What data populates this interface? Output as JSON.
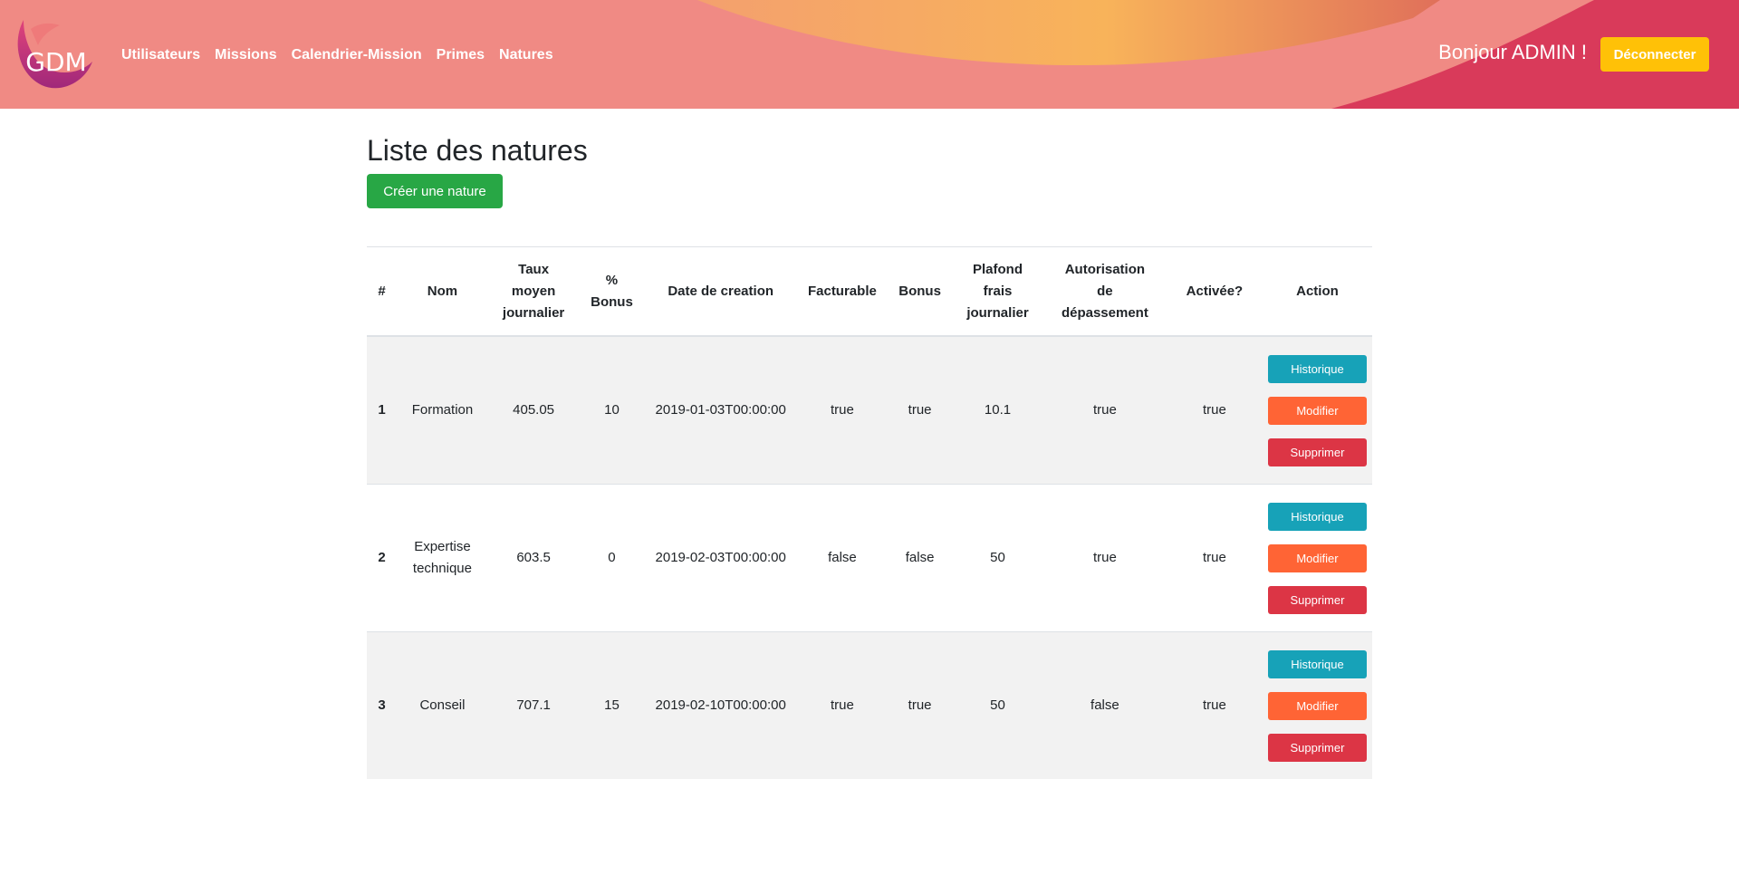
{
  "header": {
    "logo_text": "GDM",
    "nav": [
      "Utilisateurs",
      "Missions",
      "Calendrier-Mission",
      "Primes",
      "Natures"
    ],
    "greeting": "Bonjour ADMIN !",
    "logout_label": "Déconnecter",
    "colors": {
      "base": "#f08a84",
      "wave": "#f7b05a",
      "accent": "#d93a5a",
      "logout": "#ffc107"
    }
  },
  "page": {
    "title": "Liste des natures",
    "create_label": "Créer une nature"
  },
  "table": {
    "headers": {
      "idx": "#",
      "nom": "Nom",
      "taux": [
        "Taux",
        "moyen",
        "journalier"
      ],
      "bonus_pct": [
        "%",
        "Bonus"
      ],
      "date": "Date de creation",
      "facturable": "Facturable",
      "bonus": "Bonus",
      "plafond": [
        "Plafond",
        "frais",
        "journalier"
      ],
      "autorisation": [
        "Autorisation",
        "de",
        "dépassement"
      ],
      "activee": "Activée?",
      "action": "Action"
    },
    "rows": [
      {
        "idx": "1",
        "nom": [
          "Formation"
        ],
        "taux": "405.05",
        "bonus_pct": "10",
        "date": "2019-01-03T00:00:00",
        "facturable": "true",
        "bonus": "true",
        "plafond": "10.1",
        "autorisation": "true",
        "activee": "true"
      },
      {
        "idx": "2",
        "nom": [
          "Expertise",
          "technique"
        ],
        "taux": "603.5",
        "bonus_pct": "0",
        "date": "2019-02-03T00:00:00",
        "facturable": "false",
        "bonus": "false",
        "plafond": "50",
        "autorisation": "true",
        "activee": "true"
      },
      {
        "idx": "3",
        "nom": [
          "Conseil"
        ],
        "taux": "707.1",
        "bonus_pct": "15",
        "date": "2019-02-10T00:00:00",
        "facturable": "true",
        "bonus": "true",
        "plafond": "50",
        "autorisation": "false",
        "activee": "true"
      }
    ],
    "action_labels": {
      "historique": "Historique",
      "modifier": "Modifier",
      "supprimer": "Supprimer"
    }
  }
}
